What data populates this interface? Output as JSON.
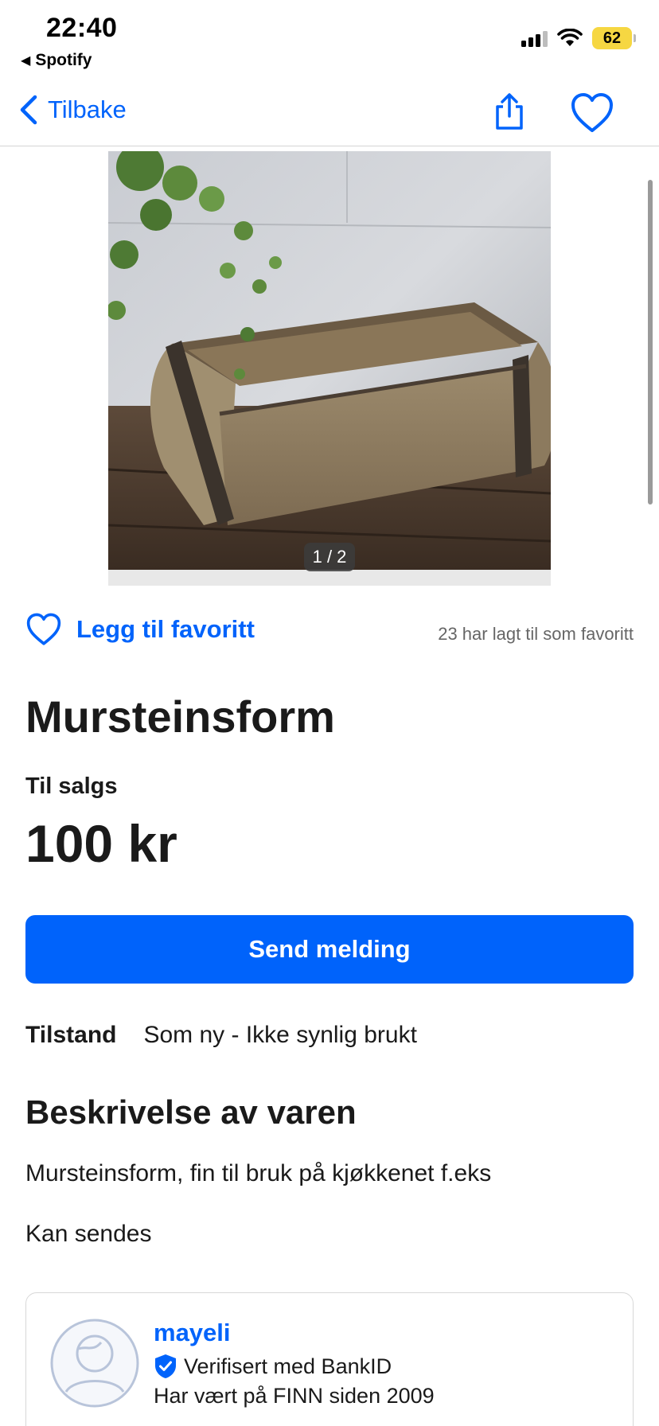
{
  "status_bar": {
    "time": "22:40",
    "back_app": "Spotify",
    "battery": "62",
    "battery_color": "#f6d742"
  },
  "nav": {
    "back_label": "Tilbake",
    "share_icon": "share-icon",
    "favorite_icon": "heart-outline-icon"
  },
  "gallery": {
    "counter": "1 / 2",
    "current_image": 1,
    "total_images": 2
  },
  "favorite": {
    "button_label": "Legg til favoritt",
    "count_text": "23 har lagt til som favoritt"
  },
  "listing": {
    "title": "Mursteinsform",
    "sale_type": "Til salgs",
    "price": "100 kr"
  },
  "actions": {
    "send_message": "Send melding"
  },
  "condition": {
    "label": "Tilstand",
    "value": "Som ny - Ikke synlig brukt"
  },
  "description": {
    "heading": "Beskrivelse av varen",
    "lines": [
      "Mursteinsform, fin til bruk på kjøkkenet f.eks",
      "Kan sendes"
    ]
  },
  "seller": {
    "name": "mayeli",
    "verified_text": "Verifisert med BankID",
    "member_since": "Har vært på FINN siden 2009"
  },
  "colors": {
    "accent": "#0063fb",
    "text": "#1a1a1a",
    "muted": "#666666"
  }
}
